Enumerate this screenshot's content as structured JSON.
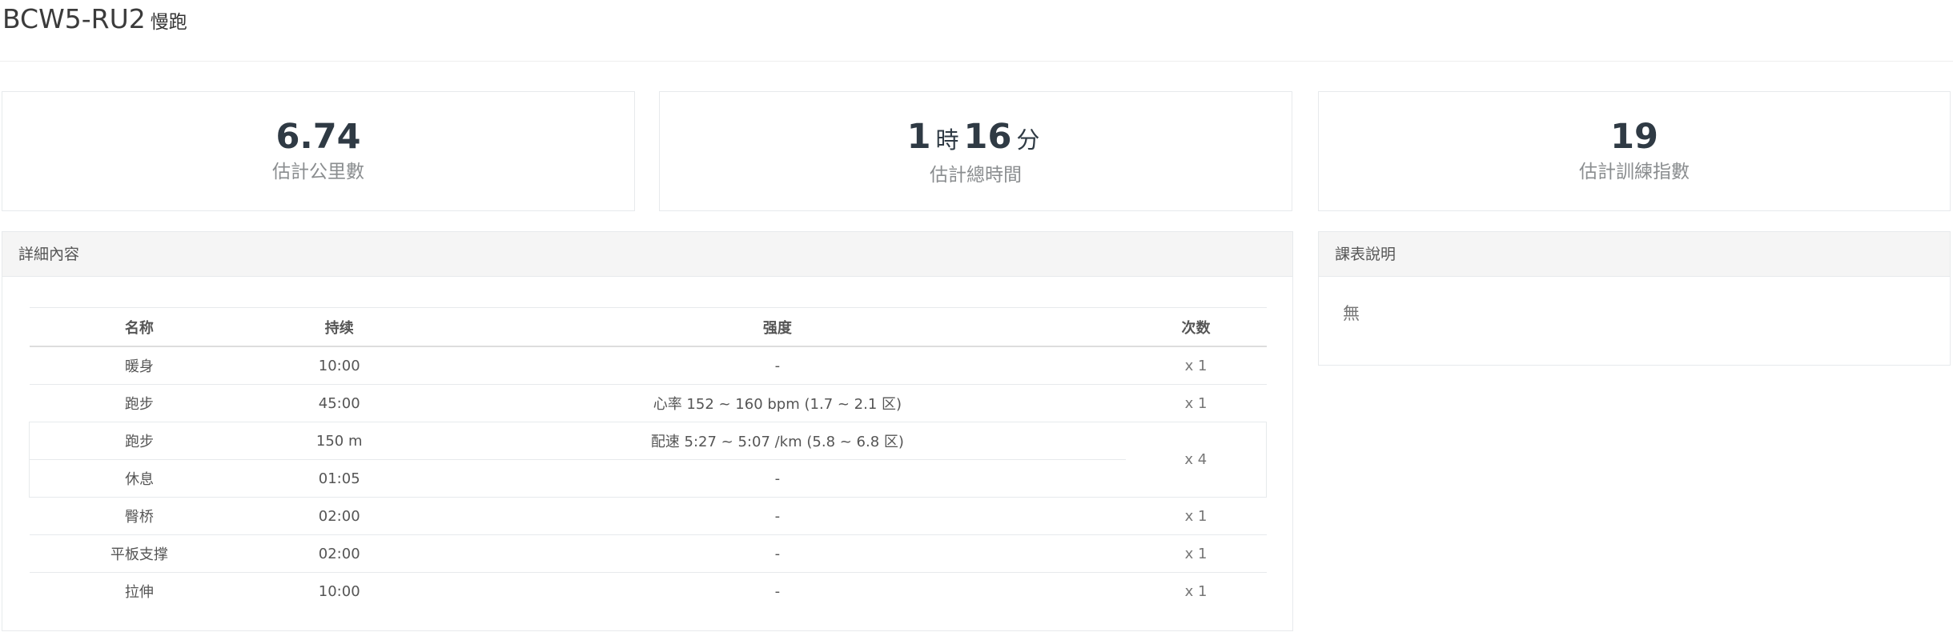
{
  "header": {
    "code": "BCW5-RU2",
    "type": "慢跑"
  },
  "stats": [
    {
      "value": "6.74",
      "label": "估計公里數"
    },
    {
      "hours": "1",
      "hours_unit": "時",
      "minutes": "16",
      "minutes_unit": "分",
      "label": "估計總時間"
    },
    {
      "value": "19",
      "label": "估計訓練指數"
    }
  ],
  "details": {
    "title": "詳細內容",
    "columns": [
      "名称",
      "持续",
      "强度",
      "次数"
    ],
    "rows": [
      {
        "name": "暖身",
        "duration": "10:00",
        "intensity": "-",
        "count": "x 1"
      },
      {
        "name": "跑步",
        "duration": "45:00",
        "intensity": "心率 152 ~ 160 bpm (1.7 ~ 2.1 区)",
        "count": "x 1"
      },
      {
        "name": "跑步",
        "duration": "150 m",
        "intensity": "配速 5:27 ~ 5:07 /km (5.8 ~ 6.8 区)",
        "count": "x 4"
      },
      {
        "name": "休息",
        "duration": "01:05",
        "intensity": "-"
      },
      {
        "name": "臀桥",
        "duration": "02:00",
        "intensity": "-",
        "count": "x 1"
      },
      {
        "name": "平板支撑",
        "duration": "02:00",
        "intensity": "-",
        "count": "x 1"
      },
      {
        "name": "拉伸",
        "duration": "10:00",
        "intensity": "-",
        "count": "x 1"
      }
    ]
  },
  "description": {
    "title": "課表說明",
    "text": "無"
  }
}
